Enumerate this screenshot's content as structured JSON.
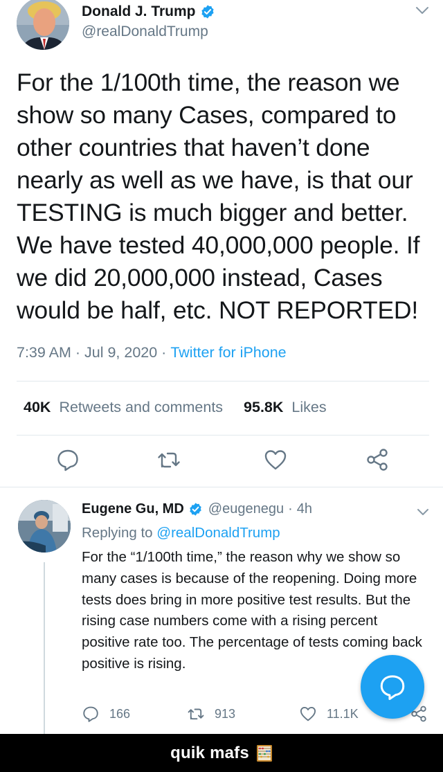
{
  "main_tweet": {
    "display_name": "Donald J. Trump",
    "handle": "@realDonaldTrump",
    "text": "For the 1/100th time, the reason we show so many Cases, compared to other countries that haven’t done nearly as well as we have, is that our TESTING is much bigger and better. We have tested 40,000,000 people. If we did 20,000,000 instead, Cases would be half, etc. NOT REPORTED!",
    "time": "7:39 AM",
    "date": "Jul 9, 2020",
    "separator": " · ",
    "source": "Twitter for iPhone",
    "retweets_count": "40K",
    "retweets_label": "Retweets and comments",
    "likes_count": "95.8K",
    "likes_label": "Likes"
  },
  "reply_tweet": {
    "display_name": "Eugene Gu, MD",
    "handle": "@eugenegu",
    "age": "4h",
    "replying_prefix": "Replying to",
    "replying_to": "@realDonaldTrump",
    "text": "For the “1/100th time,” the reason why we show so many cases is because of the reopening. Doing more tests does bring in more positive test results. But the rising case numbers come with a rising percent positive rate too. The percentage of tests coming back positive is rising.",
    "reply_count": "166",
    "retweet_count": "913",
    "like_count": "11.1K"
  },
  "footer": {
    "caption": "quik mafs"
  },
  "colors": {
    "accent": "#1da1f2",
    "secondary_text": "#657786",
    "footer_bg": "#000000"
  },
  "icons": [
    "verified-badge-icon",
    "chevron-down-icon",
    "reply-icon",
    "retweet-icon",
    "like-icon",
    "share-icon",
    "compose-icon",
    "abacus-icon"
  ]
}
